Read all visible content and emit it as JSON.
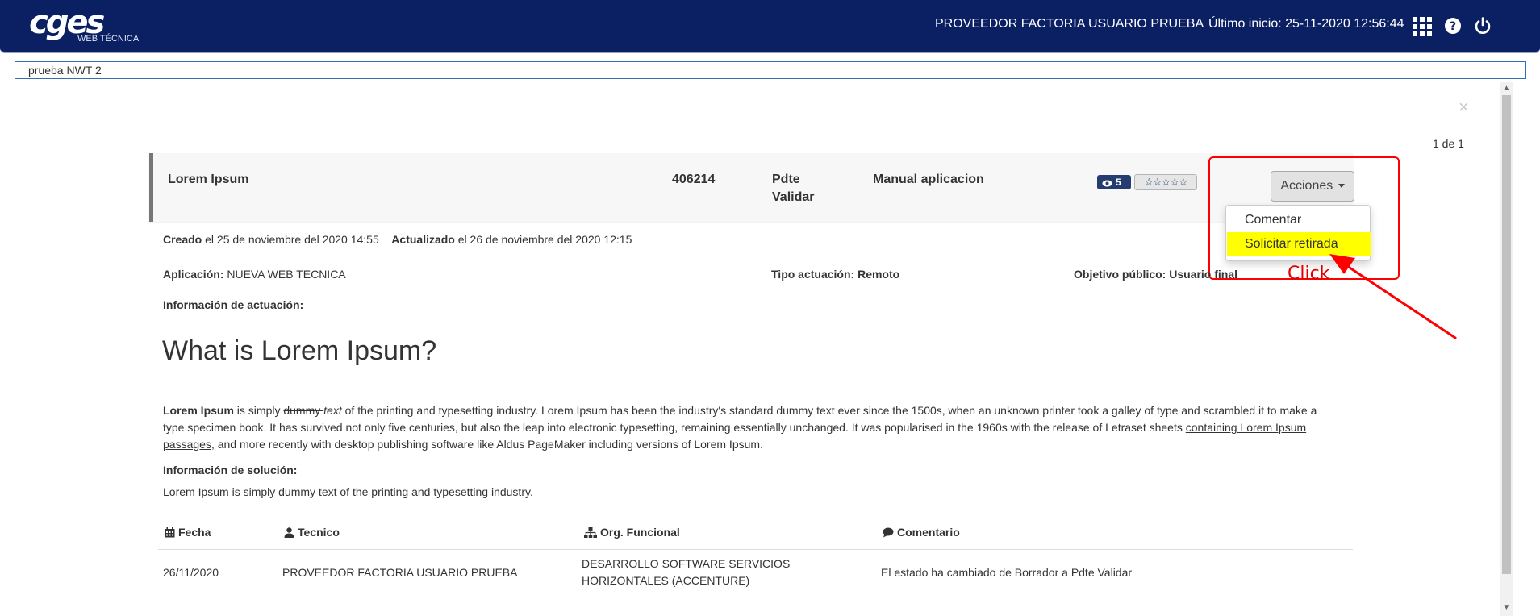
{
  "header": {
    "logo_main": "cges",
    "logo_sub": "WEB TÉCNICA",
    "user_name": "PROVEEDOR FACTORIA USUARIO PRUEBA",
    "last_login": "Último inicio: 25-11-2020 12:56:44"
  },
  "search": {
    "value": "prueba NWT 2"
  },
  "pager": "1 de 1",
  "record": {
    "title": "Lorem Ipsum",
    "id": "406214",
    "status_line1": "Pdte",
    "status_line2": "Validar",
    "type": "Manual aplicacion",
    "views": "5",
    "stars": "☆☆☆☆☆"
  },
  "actions": {
    "button_label": "Acciones",
    "menu": [
      "Comentar",
      "Solicitar retirada"
    ],
    "annotation": "Click"
  },
  "meta": {
    "created_label": "Creado",
    "created_value": "el 25 de noviembre del 2020 14:55",
    "updated_label": "Actualizado",
    "updated_value": "el 26 de noviembre del 2020 12:15",
    "app_label": "Aplicación:",
    "app_value": "NUEVA WEB TECNICA",
    "tipo": "Tipo actuación: Remoto",
    "objetivo": "Objetivo público: Usuario final",
    "info_actuacion": "Información de actuación:"
  },
  "content": {
    "heading": "What is Lorem Ipsum?",
    "p_bold": "Lorem Ipsum",
    "p_is": " is simply ",
    "p_strike": "dummy ",
    "p_italic": "text",
    "p_body": " of the printing and typesetting industry. Lorem Ipsum has been the industry's standard dummy text ever since the 1500s, when an unknown printer took a galley of type and scrambled it to make a type specimen book. It has survived not only five centuries, but also the leap into electronic typesetting, remaining essentially unchanged. It was popularised in the 1960s with the release of Letraset sheets ",
    "p_link": "containing Lorem Ipsum passages",
    "p_end": ", and more recently with desktop publishing software like Aldus PageMaker including versions of Lorem Ipsum.",
    "solucion_label": "Información de solución:",
    "solucion_text": "Lorem Ipsum is simply dummy text of the printing and typesetting industry."
  },
  "history": {
    "columns": [
      "Fecha",
      "Tecnico",
      "Org. Funcional",
      "Comentario"
    ],
    "rows": [
      {
        "fecha": "26/11/2020",
        "tecnico": "PROVEEDOR FACTORIA USUARIO PRUEBA",
        "org_line1": "DESARROLLO SOFTWARE SERVICIOS",
        "org_line2": "HORIZONTALES (ACCENTURE)",
        "comentario": "El estado ha cambiado de Borrador a Pdte Validar"
      }
    ]
  },
  "colors": {
    "topbar": "#0b1f63",
    "highlight": "#ffff00",
    "annotation": "#ff0000"
  }
}
